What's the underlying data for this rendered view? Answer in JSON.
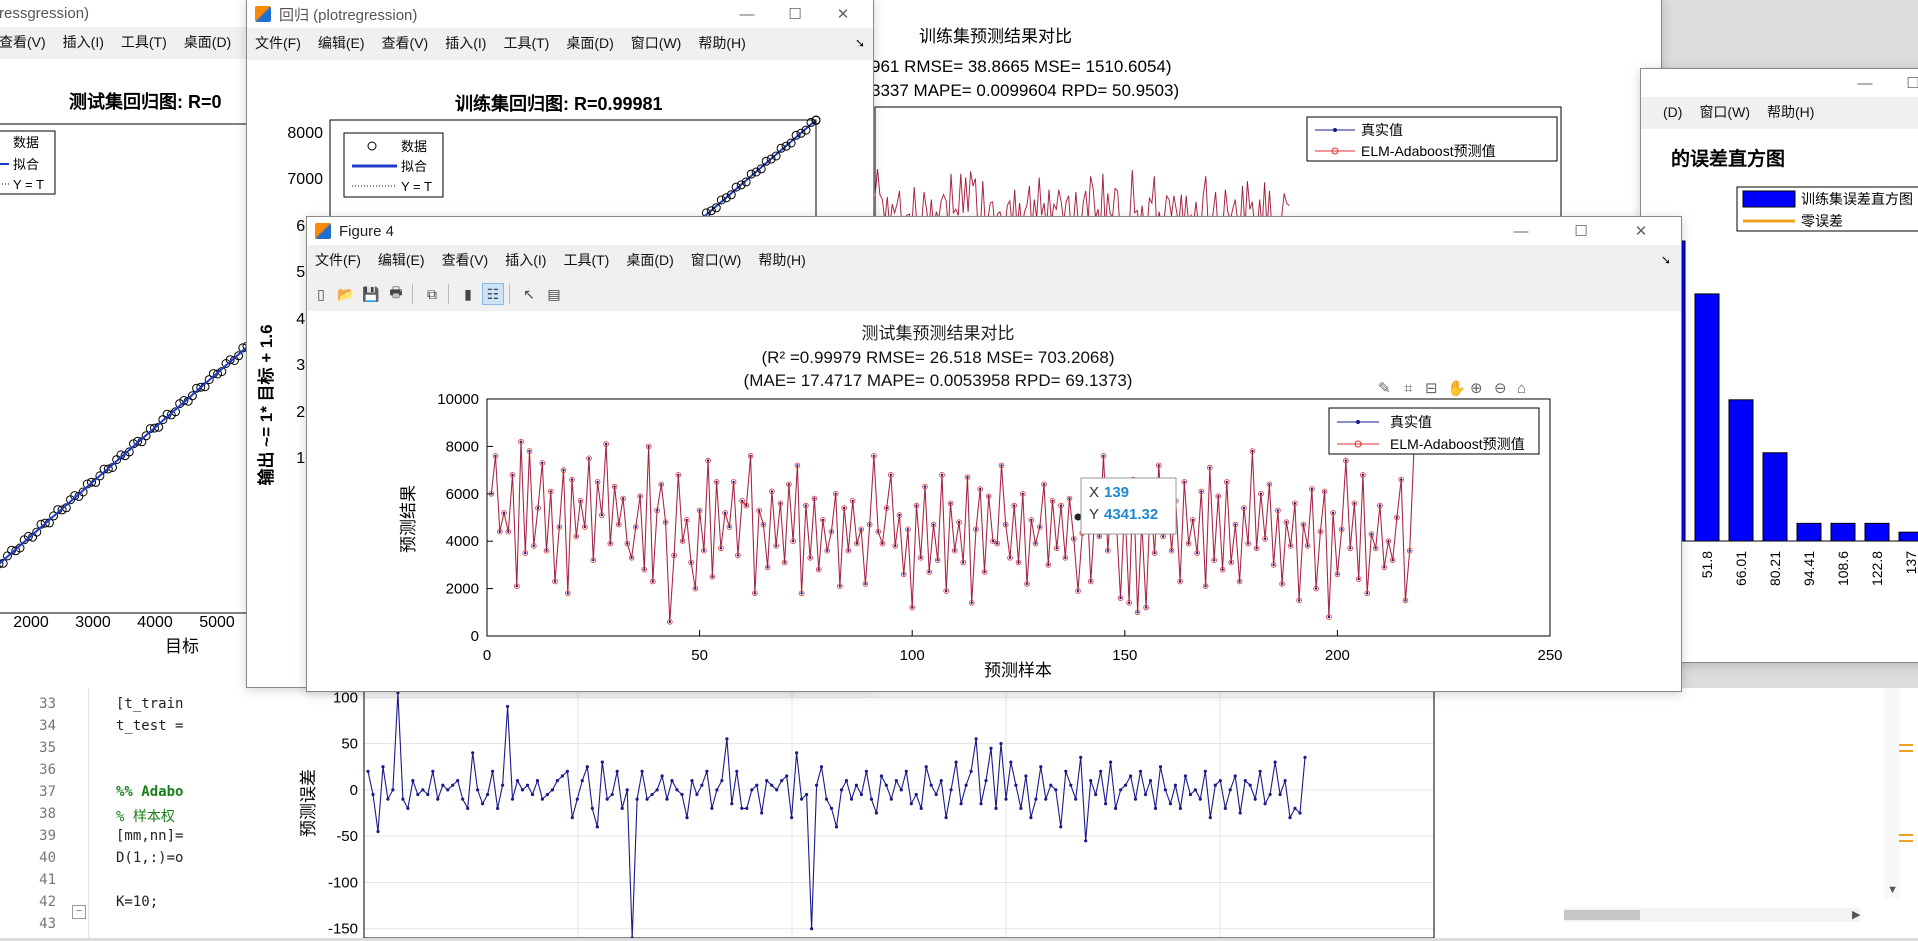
{
  "menus": {
    "w1": [
      "查看(V)",
      "插入(I)",
      "工具(T)",
      "桌面(D)"
    ],
    "w2": [
      "文件(F)",
      "编辑(E)",
      "查看(V)",
      "插入(I)",
      "工具(T)",
      "桌面(D)",
      "窗口(W)",
      "帮助(H)"
    ],
    "w3": [
      "文件(F)",
      "编辑(E)",
      "查看(V)",
      "插入(I)",
      "工具(T)",
      "桌面(D)",
      "窗口(W)",
      "帮助(H)"
    ],
    "w5": [
      "(D)",
      "窗口(W)",
      "帮助(H)"
    ]
  },
  "editor": {
    "lines": [
      {
        "n": "33",
        "text": "[t_train",
        "style": ""
      },
      {
        "n": "34",
        "text": "t_test =",
        "style": ""
      },
      {
        "n": "35",
        "text": "",
        "style": ""
      },
      {
        "n": "36",
        "text": "",
        "style": ""
      },
      {
        "n": "37",
        "text": "%% Adabo",
        "style": "green bold"
      },
      {
        "n": "38",
        "text": "% 样本权",
        "style": "green"
      },
      {
        "n": "39",
        "text": "[mm,nn]=",
        "style": ""
      },
      {
        "n": "40",
        "text": "D(1,:)=o",
        "style": ""
      },
      {
        "n": "41",
        "text": "",
        "style": ""
      },
      {
        "n": "42",
        "text": "K=10;",
        "style": ""
      },
      {
        "n": "43",
        "text": "",
        "style": ""
      }
    ]
  },
  "w1": {
    "title": "ressgression)",
    "plot_title": "测试集回归图: R=0",
    "legend": [
      "数据",
      "拟合",
      "Y = T"
    ],
    "xticks": [
      "2000",
      "3000",
      "4000",
      "5000"
    ],
    "xlabel": "目标"
  },
  "w2": {
    "title": "回归 (plotregression)",
    "plot_title": "训练集回归图: R=0.99981",
    "legend": [
      "数据",
      "拟合",
      "Y = T"
    ],
    "ylabel": "输出 ~= 1* 目标 + 1.6",
    "yticks": [
      "8000",
      "7000",
      "600",
      "500",
      "400",
      "300",
      "200",
      "100"
    ]
  },
  "w_back": {
    "title": "训练集预测结果对比",
    "stats1": "961 RMSE= 38.8665 MSE= 1510.6054)",
    "stats2": "3337 MAPE= 0.0099604 RPD= 50.9503)",
    "legend": [
      "真实值",
      "ELM-Adaboost预测值"
    ]
  },
  "w5": {
    "plot_title": "的误差直方图",
    "legend": [
      "训练集误差直方图",
      "零误差"
    ],
    "xticks": [
      "37.6",
      "51.8",
      "66.01",
      "80.21",
      "94.41",
      "108.6",
      "122.8",
      "137"
    ],
    "bar_color": "#0000ff",
    "zero_color": "#f0a020"
  },
  "w_err": {
    "ylabel": "预测误差",
    "yticks": [
      "100",
      "50",
      "0",
      "-50",
      "-100",
      "-150"
    ]
  },
  "w3": {
    "title": "Figure 4",
    "toolbar": [
      "new-icon",
      "open-icon",
      "save-icon",
      "print-icon",
      "print-preview-icon",
      "colorbar-icon",
      "legend-icon",
      "pointer-icon",
      "property-editor-icon"
    ],
    "axes_tools": [
      "brush-icon",
      "edit-icon",
      "data-tips-icon",
      "pan-icon",
      "zoom-in-icon",
      "zoom-out-icon",
      "home-icon"
    ],
    "datatip": {
      "x_label": "X",
      "x_value": "139",
      "y_label": "Y",
      "y_value": "4341.32",
      "accent": "#1f8ad0"
    }
  },
  "chart_data": [
    {
      "type": "line",
      "title": "测试集预测结果对比",
      "subtitle": [
        "(R² =0.99979 RMSE= 26.518 MSE= 703.2068)",
        "(MAE= 17.4717 MAPE= 0.0053958 RPD= 69.1373)"
      ],
      "xlabel": "预测样本",
      "ylabel": "预测结果",
      "xlim": [
        0,
        250
      ],
      "ylim": [
        0,
        10000
      ],
      "xticks": [
        0,
        50,
        100,
        150,
        200,
        250
      ],
      "yticks": [
        0,
        2000,
        4000,
        6000,
        8000,
        10000
      ],
      "legend_position": "top-right",
      "series": [
        {
          "name": "真实值",
          "color": "#1a1a8c"
        },
        {
          "name": "ELM-Adaboost预测值",
          "color": "#e03030"
        }
      ],
      "x": [
        1,
        2,
        3,
        4,
        5,
        6,
        7,
        8,
        9,
        10,
        11,
        12,
        13,
        14,
        15,
        16,
        17,
        18,
        19,
        20,
        21,
        22,
        23,
        24,
        25,
        26,
        27,
        28,
        29,
        30,
        31,
        32,
        33,
        34,
        35,
        36,
        37,
        38,
        39,
        40,
        41,
        42,
        43,
        44,
        45,
        46,
        47,
        48,
        49,
        50,
        51,
        52,
        53,
        54,
        55,
        56,
        57,
        58,
        59,
        60,
        61,
        62,
        63,
        64,
        65,
        66,
        67,
        68,
        69,
        70,
        71,
        72,
        73,
        74,
        75,
        76,
        77,
        78,
        79,
        80,
        81,
        82,
        83,
        84,
        85,
        86,
        87,
        88,
        89,
        90,
        91,
        92,
        93,
        94,
        95,
        96,
        97,
        98,
        99,
        100,
        101,
        102,
        103,
        104,
        105,
        106,
        107,
        108,
        109,
        110,
        111,
        112,
        113,
        114,
        115,
        116,
        117,
        118,
        119,
        120,
        121,
        122,
        123,
        124,
        125,
        126,
        127,
        128,
        129,
        130,
        131,
        132,
        133,
        134,
        135,
        136,
        137,
        138,
        139,
        140,
        141,
        142,
        143,
        144,
        145,
        146,
        147,
        148,
        149,
        150,
        151,
        152,
        153,
        154,
        155,
        156,
        157,
        158,
        159,
        160,
        161,
        162,
        163,
        164,
        165,
        166,
        167,
        168,
        169,
        170,
        171,
        172,
        173,
        174,
        175,
        176,
        177,
        178,
        179,
        180,
        181,
        182,
        183,
        184,
        185,
        186,
        187,
        188,
        189,
        190,
        191,
        192,
        193,
        194,
        195,
        196,
        197,
        198,
        199,
        200,
        201,
        202,
        203,
        204,
        205,
        206,
        207,
        208,
        209,
        210,
        211,
        212,
        213,
        214,
        215,
        216,
        217,
        218
      ],
      "values": [
        6000,
        7600,
        4400,
        5200,
        4400,
        6800,
        2100,
        8200,
        3500,
        7800,
        3800,
        5400,
        7300,
        3600,
        6100,
        2300,
        4600,
        7000,
        1800,
        6600,
        4200,
        5700,
        4600,
        7500,
        3200,
        6500,
        5100,
        8100,
        3900,
        6300,
        4700,
        5800,
        3900,
        3300,
        4600,
        5900,
        2800,
        8000,
        2300,
        5300,
        6400,
        4800,
        600,
        3400,
        6800,
        4000,
        4900,
        3100,
        2000,
        5300,
        3600,
        7400,
        2500,
        6500,
        3700,
        5200,
        4600,
        6500,
        3400,
        5700,
        5500,
        7600,
        1800,
        5300,
        4700,
        2900,
        6100,
        3800,
        5600,
        3100,
        6400,
        4000,
        7200,
        1800,
        5500,
        3300,
        5800,
        2800,
        4900,
        3600,
        4400,
        6000,
        2100,
        5400,
        3600,
        5700,
        3900,
        4500,
        2200,
        4700,
        7600,
        4400,
        3900,
        5400,
        6800,
        3800,
        5100,
        2600,
        4500,
        1200,
        5500,
        3300,
        6300,
        2700,
        4700,
        3200,
        6800,
        1900,
        5600,
        3600,
        4800,
        3100,
        6700,
        1400,
        4500,
        6200,
        2700,
        5900,
        4000,
        3900,
        7200,
        4700,
        3300,
        5500,
        3100,
        6000,
        2200,
        4900,
        3900,
        4600,
        6400,
        3000,
        5700,
        3700,
        5500,
        3300,
        5800,
        4100,
        1900,
        4341,
        6300,
        2300,
        5200,
        4200,
        7600,
        3600,
        6000,
        4900,
        1600,
        5600,
        1400,
        6600,
        1000,
        4800,
        1200,
        5700,
        3500,
        7200,
        4200,
        5900,
        3600,
        5700,
        2300,
        6500,
        3900,
        4900,
        3500,
        6100,
        2100,
        7100,
        3200,
        5900,
        2800,
        6500,
        3100,
        4700,
        2300,
        5400,
        3900,
        7800,
        3700,
        6000,
        4100,
        6400,
        3000,
        5300,
        2200,
        4800,
        3800,
        5600,
        1500,
        4700,
        3800,
        6200,
        2000,
        4400,
        6100,
        800,
        5200,
        2600,
        4500,
        7400,
        3700,
        5600,
        2400,
        6800,
        1800,
        4300,
        3700,
        5500,
        2900,
        4000,
        3200,
        5000,
        6600,
        1500,
        3600,
        7800,
        4300,
        5700,
        4700,
        6400,
        3100,
        3000,
        4600,
        6200,
        4200,
        5300,
        2300,
        3200,
        6100,
        4900,
        5400,
        7500,
        7100,
        4200
      ]
    },
    {
      "type": "scatter",
      "title": "训练集回归图: R=0.99981",
      "xlabel": "目标",
      "ylabel": "输出 ~= 1* 目标 + 1.6",
      "note": "points lie along the line y = x"
    },
    {
      "type": "bar",
      "title": "的误差直方图",
      "categories": [
        "37.6",
        "51.8",
        "66.01",
        "80.21",
        "94.41",
        "108.6",
        "122.8",
        "137"
      ],
      "values": [
        34,
        28,
        16,
        10,
        2,
        2,
        2,
        1
      ]
    },
    {
      "type": "line",
      "ylabel": "预测误差",
      "ylim": [
        -160,
        110
      ],
      "values": [
        20,
        -5,
        -45,
        25,
        -10,
        0,
        105,
        -10,
        -20,
        10,
        -5,
        0,
        -5,
        20,
        -10,
        5,
        0,
        5,
        10,
        -10,
        -20,
        40,
        0,
        -15,
        -5,
        20,
        -20,
        5,
        90,
        -10,
        10,
        0,
        5,
        -5,
        10,
        -10,
        -5,
        0,
        10,
        15,
        20,
        -30,
        -10,
        10,
        25,
        -20,
        -40,
        30,
        -10,
        -5,
        20,
        -20,
        0,
        -160,
        -10,
        20,
        -10,
        -5,
        0,
        15,
        -10,
        10,
        0,
        -5,
        -30,
        10,
        -5,
        5,
        20,
        -20,
        0,
        10,
        55,
        -15,
        20,
        -20,
        -20,
        0,
        5,
        -25,
        10,
        5,
        0,
        10,
        15,
        -30,
        40,
        -10,
        -5,
        -150,
        5,
        25,
        -10,
        -20,
        -40,
        0,
        10,
        -10,
        5,
        -5,
        20,
        -10,
        -25,
        15,
        5,
        -10,
        10,
        0,
        20,
        -15,
        -5,
        -20,
        25,
        5,
        -5,
        10,
        -30,
        0,
        30,
        -15,
        5,
        20,
        55,
        -15,
        10,
        45,
        -20,
        50,
        -10,
        30,
        5,
        -20,
        15,
        -30,
        -10,
        25,
        -10,
        5,
        0,
        -40,
        20,
        5,
        -10,
        35,
        -55,
        10,
        -5,
        20,
        -15,
        30,
        -20,
        0,
        5,
        15,
        -10,
        20,
        -5,
        10,
        -20,
        25,
        0,
        -15,
        5,
        -20,
        15,
        -5,
        0,
        -10,
        20,
        -30,
        5,
        10,
        -20,
        0,
        15,
        -25,
        10,
        5,
        -10,
        20,
        -15,
        -5,
        30,
        -5,
        10,
        -30,
        -20,
        -25,
        35
      ]
    }
  ]
}
